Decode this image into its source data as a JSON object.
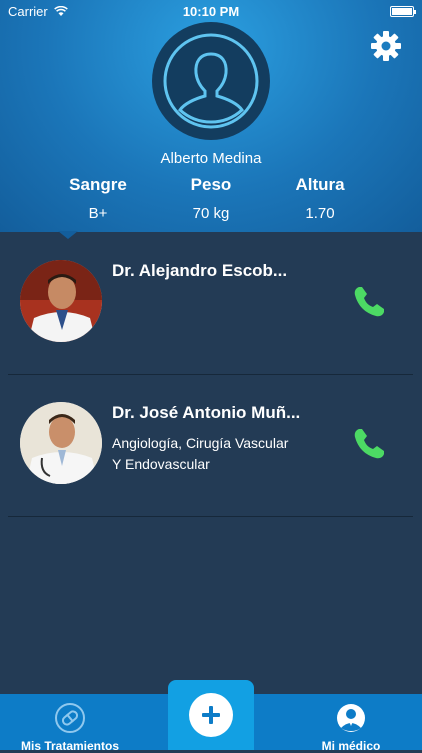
{
  "status_bar": {
    "carrier": "Carrier",
    "time": "10:10 PM"
  },
  "profile": {
    "name": "Alberto Medina"
  },
  "stats": [
    {
      "label": "Sangre",
      "value": "B+"
    },
    {
      "label": "Peso",
      "value": "70 kg"
    },
    {
      "label": "Altura",
      "value": "1.70"
    }
  ],
  "doctors": [
    {
      "name": "Dr. Alejandro Escob...",
      "specialty_line1": "",
      "specialty_line2": ""
    },
    {
      "name": "Dr. José Antonio Muñ...",
      "specialty_line1": "Angiología, Cirugía Vascular",
      "specialty_line2": "Y Endovascular"
    }
  ],
  "tabbar": {
    "left_label": "Mis Tratamientos",
    "right_label": "Mi médico"
  },
  "colors": {
    "accent": "#1b76b9",
    "call_green": "#4cd964",
    "tabbar": "#0d7cc7"
  },
  "icons": {
    "settings": "gear-icon",
    "call": "phone-icon",
    "add": "plus-icon",
    "treatments": "pill-icon",
    "doctor": "doctor-icon"
  }
}
